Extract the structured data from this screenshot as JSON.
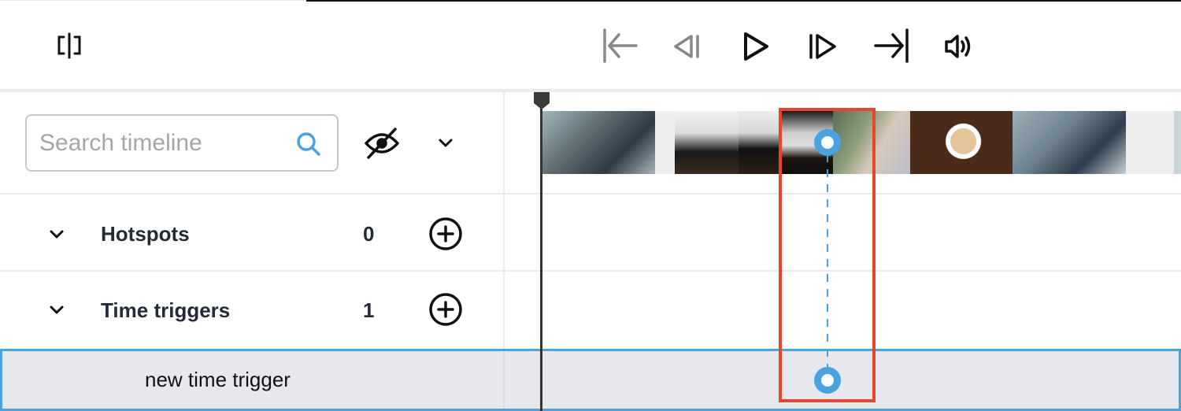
{
  "toolbar": {
    "split_view_icon": "split-view-icon",
    "controls": [
      {
        "name": "skip-to-start",
        "icon": "skip-to-start-icon",
        "enabled": false
      },
      {
        "name": "step-back",
        "icon": "step-back-icon",
        "enabled": false
      },
      {
        "name": "play",
        "icon": "play-icon",
        "enabled": true
      },
      {
        "name": "step-forward",
        "icon": "step-forward-icon",
        "enabled": true
      },
      {
        "name": "skip-to-end",
        "icon": "skip-to-end-icon",
        "enabled": true
      },
      {
        "name": "volume",
        "icon": "volume-icon",
        "enabled": true
      }
    ]
  },
  "search": {
    "placeholder": "Search timeline",
    "value": ""
  },
  "visibility_toggle_icon": "eye-slash-icon",
  "filter_dropdown_icon": "chevron-down-icon",
  "groups": [
    {
      "label": "Hotspots",
      "count": "0",
      "expanded": true
    },
    {
      "label": "Time triggers",
      "count": "1",
      "expanded": true
    }
  ],
  "selected_item": {
    "label": "new time trigger"
  },
  "filmstrip": {
    "thumbnails": [
      "office-meeting",
      "coffee-press",
      "coffee-press",
      "coffee-press-pour",
      "typing-laptop",
      "coffee-cup-beans",
      "open-office",
      "blank",
      "faded-office"
    ]
  },
  "colors": {
    "accent": "#4aa3e0",
    "highlight": "#e8452c",
    "selected_bg": "#e6e8ee",
    "text": "#222b36"
  }
}
